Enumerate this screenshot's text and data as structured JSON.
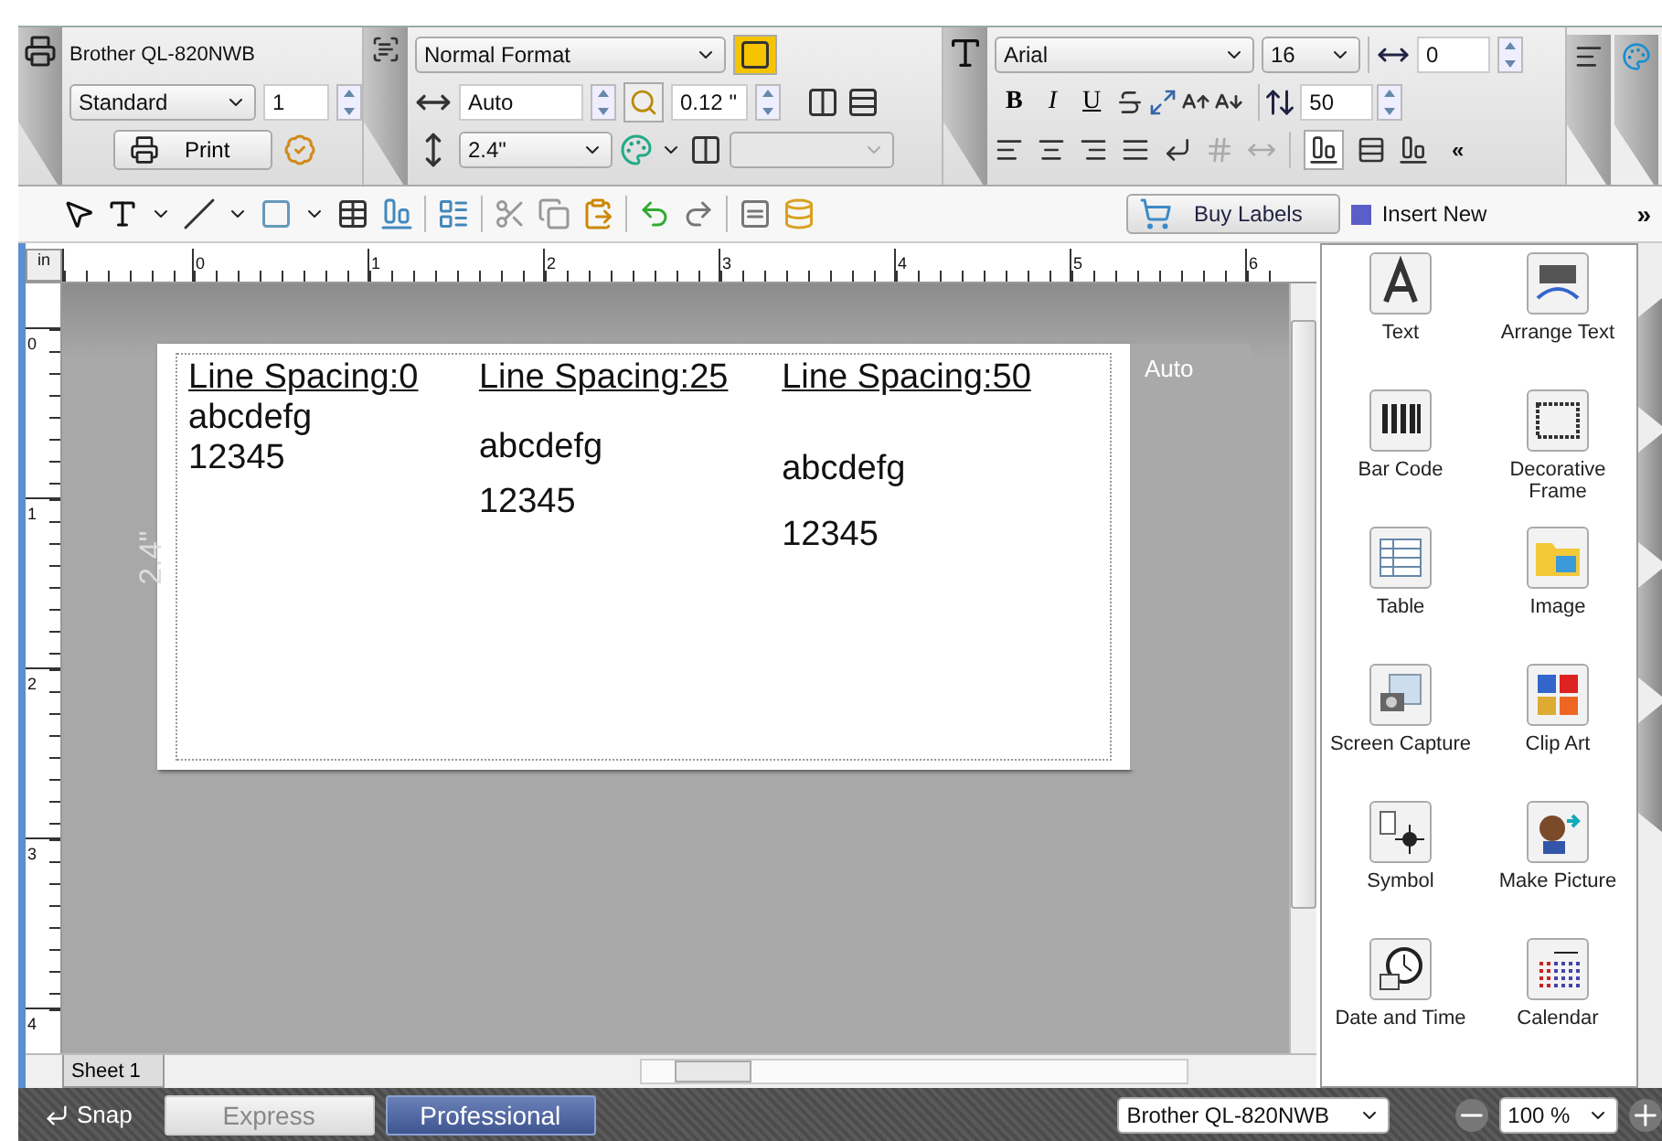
{
  "printer_panel": {
    "printer": "Brother QL-820NWB",
    "mode": "Standard",
    "copies": "1",
    "print_button": "Print"
  },
  "format_panel": {
    "format": "Normal Format",
    "length": "Auto",
    "margin": "0.12 \"",
    "height": "2.4\""
  },
  "font_panel": {
    "font": "Arial",
    "size": "16",
    "char_spacing": "0",
    "line_spacing": "50",
    "style_buttons": [
      "B",
      "I",
      "U"
    ],
    "collapse": "«"
  },
  "toolbar": {
    "buy_labels": "Buy Labels"
  },
  "ruler": {
    "unit": "in",
    "h_ticks": [
      "0",
      "1",
      "2",
      "3",
      "4",
      "5",
      "6"
    ],
    "v_ticks": [
      "0",
      "1",
      "2",
      "3",
      "4"
    ]
  },
  "label": {
    "height_text": "2.4\"",
    "length_text": "Auto",
    "columns": [
      {
        "heading": "Line Spacing:0",
        "kind": "tight",
        "lines": [
          "abcdefg",
          "12345"
        ]
      },
      {
        "heading": "Line Spacing:25",
        "kind": "medium",
        "lines": [
          "abcdefg",
          "12345"
        ]
      },
      {
        "heading": "Line Spacing:50",
        "kind": "loose",
        "lines": [
          "abcdefg",
          "12345"
        ]
      }
    ]
  },
  "sheets": [
    {
      "label": "Sheet 1",
      "selected": true
    }
  ],
  "insert_panel": {
    "title": "Insert New",
    "collapse": "»",
    "items": [
      {
        "label": "Text"
      },
      {
        "label": "Arrange Text"
      },
      {
        "label": "Bar Code"
      },
      {
        "label": "Decorative Frame"
      },
      {
        "label": "Table"
      },
      {
        "label": "Image"
      },
      {
        "label": "Screen Capture"
      },
      {
        "label": "Clip Art"
      },
      {
        "label": "Symbol"
      },
      {
        "label": "Make Picture"
      },
      {
        "label": "Date and Time"
      },
      {
        "label": "Calendar"
      }
    ]
  },
  "status_bar": {
    "snap": "Snap",
    "modes": [
      {
        "label": "Express",
        "selected": false
      },
      {
        "label": "Professional",
        "selected": true
      }
    ],
    "printer": "Brother QL-820NWB",
    "zoom": "100 %"
  }
}
